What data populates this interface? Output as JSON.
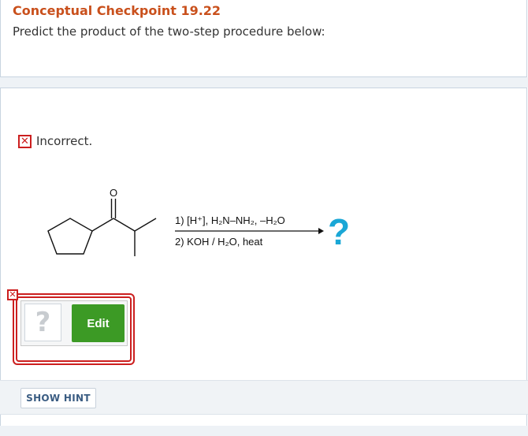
{
  "header": {
    "title": "Conceptual Checkpoint 19.22",
    "prompt": "Predict the product of the two-step procedure below:"
  },
  "result": {
    "status_icon": "x-mark-icon",
    "text": "Incorrect."
  },
  "reaction": {
    "reactant_atom_label": "O",
    "step1": "1) [H⁺], H₂N–NH₂, –H₂O",
    "step2": "2) KOH / H₂O, heat",
    "product_symbol": "?"
  },
  "answer": {
    "placeholder_symbol": "?",
    "edit_label": "Edit"
  },
  "hint": {
    "label": "SHOW HINT"
  },
  "colors": {
    "title": "#c9501c",
    "error": "#cc1f1f",
    "edit_button": "#3c9a25",
    "question_mark": "#1aa7d6"
  }
}
